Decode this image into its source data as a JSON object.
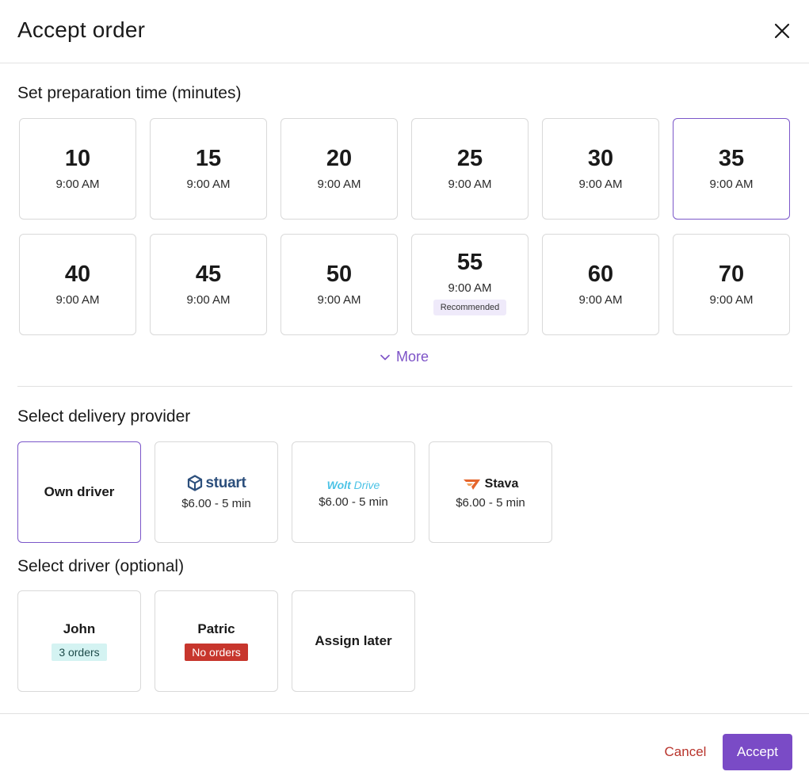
{
  "header": {
    "title": "Accept order"
  },
  "prep": {
    "title": "Set preparation time (minutes)",
    "options": [
      {
        "minutes": "10",
        "time": "9:00 AM"
      },
      {
        "minutes": "15",
        "time": "9:00 AM"
      },
      {
        "minutes": "20",
        "time": "9:00 AM"
      },
      {
        "minutes": "25",
        "time": "9:00 AM"
      },
      {
        "minutes": "30",
        "time": "9:00 AM"
      },
      {
        "minutes": "35",
        "time": "9:00 AM"
      },
      {
        "minutes": "40",
        "time": "9:00 AM"
      },
      {
        "minutes": "45",
        "time": "9:00 AM"
      },
      {
        "minutes": "50",
        "time": "9:00 AM"
      },
      {
        "minutes": "55",
        "time": "9:00 AM",
        "badge": "Recommended"
      },
      {
        "minutes": "60",
        "time": "9:00 AM"
      },
      {
        "minutes": "70",
        "time": "9:00 AM"
      }
    ],
    "selected": "35",
    "more_label": "More"
  },
  "delivery": {
    "title": "Select delivery provider",
    "providers": [
      {
        "label": "Own driver"
      },
      {
        "logo": "stuart",
        "price": "$6.00 - 5 min"
      },
      {
        "logo_bold": "Wolt",
        "logo_light": "Drive",
        "price": "$6.00 - 5 min"
      },
      {
        "logo": "Stava",
        "price": "$6.00 - 5 min"
      }
    ]
  },
  "driver": {
    "title": "Select driver (optional)",
    "options": [
      {
        "name": "John",
        "badge": "3 orders"
      },
      {
        "name": "Patric",
        "badge": "No orders"
      },
      {
        "name": "Assign later"
      }
    ]
  },
  "footer": {
    "cancel_label": "Cancel",
    "accept_label": "Accept"
  },
  "colors": {
    "accent": "#7a4bc6",
    "danger": "#c7362d",
    "info_bg": "#d4f3f2",
    "border": "#d9d9d9"
  }
}
